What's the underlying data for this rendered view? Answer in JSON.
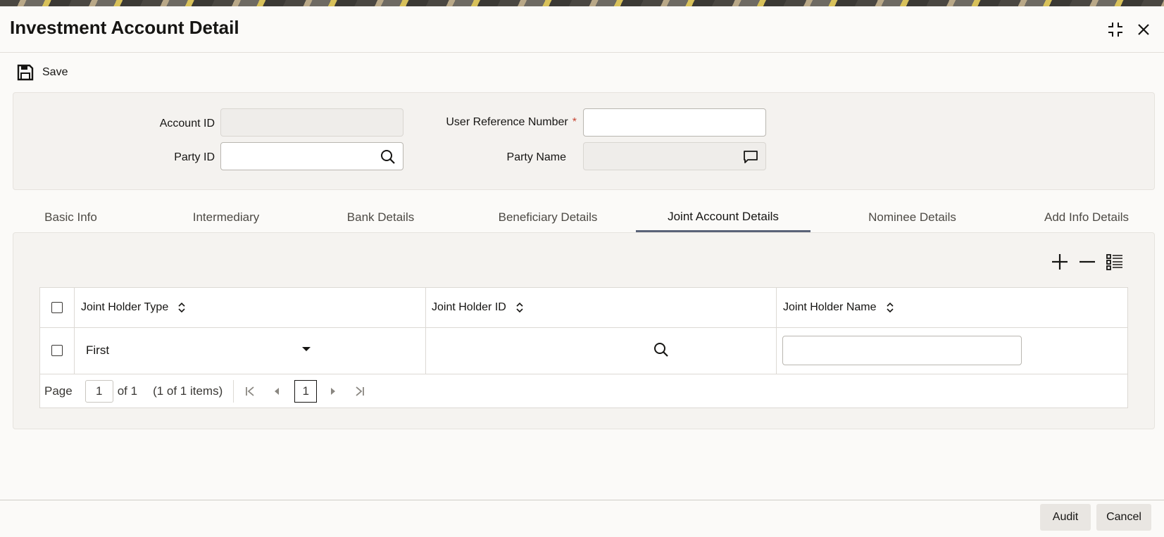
{
  "window": {
    "title": "Investment Account Detail"
  },
  "toolbar": {
    "save_label": "Save"
  },
  "form": {
    "account_id": {
      "label": "Account ID",
      "value": ""
    },
    "user_reference_number": {
      "label": "User Reference Number",
      "required_mark": "*",
      "value": ""
    },
    "party_id": {
      "label": "Party ID",
      "value": ""
    },
    "party_name": {
      "label": "Party Name",
      "value": ""
    }
  },
  "tabs": [
    {
      "label": "Basic Info"
    },
    {
      "label": "Intermediary"
    },
    {
      "label": "Bank Details"
    },
    {
      "label": "Beneficiary Details"
    },
    {
      "label": "Joint Account Details"
    },
    {
      "label": "Nominee Details"
    },
    {
      "label": "Add Info Details"
    }
  ],
  "active_tab": "Joint Account Details",
  "grid": {
    "columns": [
      "Joint Holder Type",
      "Joint Holder ID",
      "Joint Holder Name"
    ],
    "rows": [
      {
        "joint_holder_type": "First",
        "joint_holder_id": "",
        "joint_holder_name": ""
      }
    ]
  },
  "pagination": {
    "page_label": "Page",
    "current_page": "1",
    "of_label": "of 1",
    "items_label": "(1 of 1 items)",
    "page_button": "1"
  },
  "footer": {
    "audit_label": "Audit",
    "cancel_label": "Cancel"
  },
  "colors": {
    "accent_underline": "#5a6378",
    "required": "#c74634"
  }
}
